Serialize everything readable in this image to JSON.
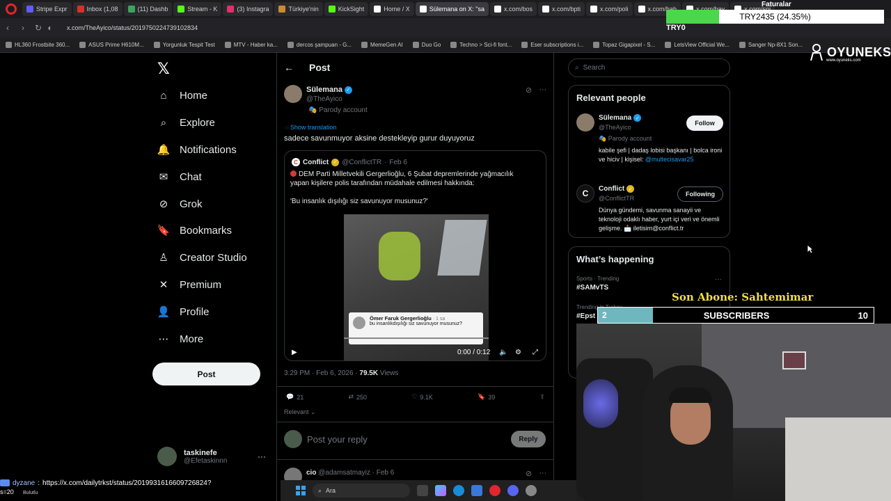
{
  "browser": {
    "tabs": [
      {
        "label": "Stripe Expr",
        "color": "#635bff",
        "active": false
      },
      {
        "label": "Inbox (1,08",
        "color": "#d93025",
        "active": false
      },
      {
        "label": "(11) Dashb",
        "color": "#3aa55d",
        "active": false
      },
      {
        "label": "Stream - K",
        "color": "#53fc18",
        "active": false
      },
      {
        "label": "(3) Instagra",
        "color": "#e1306c",
        "active": false
      },
      {
        "label": "Türkiye'nin",
        "color": "#c98c2d",
        "active": false
      },
      {
        "label": "KickSight",
        "color": "#53fc18",
        "active": false
      },
      {
        "label": "Home / X",
        "color": "#ffffff",
        "active": false
      },
      {
        "label": "Sülemana on X: \"sa",
        "color": "#ffffff",
        "active": true
      },
      {
        "label": "x.com/bos",
        "color": "#ffffff",
        "active": false
      },
      {
        "label": "x.com/bpti",
        "color": "#ffffff",
        "active": false
      },
      {
        "label": "x.com/poli",
        "color": "#ffffff",
        "active": false
      },
      {
        "label": "x.com/hab",
        "color": "#ffffff",
        "active": false
      },
      {
        "label": "x.com/bay",
        "color": "#ffffff",
        "active": false
      },
      {
        "label": "x.com/spi",
        "color": "#ffffff",
        "active": false
      }
    ],
    "url": "x.com/TheAyico/status/2019750224739102834",
    "bookmarks": [
      "HL360 Frostbite 360...",
      "ASUS Prime H610M...",
      "Yorgunluk Tespit Test",
      "MTV - Haber ka...",
      "dercos şampuan - G...",
      "MemeGen AI",
      "Duo Go",
      "Techno > Sci-fi font...",
      "Eser subscriptions i...",
      "Topaz Gigapixel - S...",
      "LetsView Official We...",
      "Sanger Np-8X1 Son..."
    ]
  },
  "nav": {
    "items": [
      {
        "label": "Home",
        "icon": "home-icon"
      },
      {
        "label": "Explore",
        "icon": "search-icon"
      },
      {
        "label": "Notifications",
        "icon": "bell-icon"
      },
      {
        "label": "Chat",
        "icon": "mail-icon"
      },
      {
        "label": "Grok",
        "icon": "grok-icon"
      },
      {
        "label": "Bookmarks",
        "icon": "bookmark-icon"
      },
      {
        "label": "Creator Studio",
        "icon": "creator-icon"
      },
      {
        "label": "Premium",
        "icon": "x-icon"
      },
      {
        "label": "Profile",
        "icon": "person-icon"
      },
      {
        "label": "More",
        "icon": "more-icon"
      }
    ],
    "post_label": "Post",
    "user_name": "taskinefe",
    "user_handle": "@Efetaskinnn"
  },
  "post": {
    "header": "Post",
    "author_name": "Sülemana",
    "author_handle": "@TheAyico",
    "parody_label": "Parody account",
    "translate_label": "Show translation",
    "text": "sadece savunmuyor aksine destekleyip gurur duyuyoruz",
    "quote": {
      "avatar_letter": "C",
      "name": "Conflict",
      "handle": "@ConflictTR",
      "date": "Feb 6",
      "text": "DEM Parti Milletvekili Gergerlioğlu, 6 Şubat depremlerinde yağmacılık yapan kişilere polis tarafından müdahale edilmesi hakkında:\n\n'Bu insanlık dışılığı siz savunuyor musunuz?'",
      "card_name": "Ömer Faruk Gergerlioğlu",
      "card_time": "1 sa",
      "card_text": "bu insanlıkdışılığı siz savunuyor musunuz?",
      "video_time": "0:00 / 0:12"
    },
    "time": "3:29 PM",
    "date": "Feb 6, 2026",
    "views": "79.5K",
    "views_label": "Views",
    "replies": "21",
    "reposts": "250",
    "likes": "9.1K",
    "bookmarks": "39",
    "sort_label": "Relevant",
    "reply_placeholder": "Post your reply",
    "reply_button": "Reply",
    "next_reply_name": "cio",
    "next_reply_handle": "@adamsatmayiz",
    "next_reply_date": "Feb 6"
  },
  "sidebar": {
    "search_placeholder": "Search",
    "relevant_title": "Relevant people",
    "people": [
      {
        "name": "Sülemana",
        "handle": "@TheAyico",
        "parody": "Parody account",
        "bio": "kabile şefi | dadaş lobisi başkanı | bolca ironi ve hiciv | kişisel:",
        "bio_link": "@multecisavar25",
        "button": "Follow"
      },
      {
        "name": "Conflict",
        "handle": "@ConflictTR",
        "bio": "Dünya gündemi, savunma sanayii ve teknoloji odaklı haber, yurt içi veri ve önemli gelişme. 📩 iletisim@conflict.tr",
        "button": "Following"
      }
    ],
    "happening_title": "What’s happening",
    "trends": [
      {
        "category": "Sports · Trending",
        "name": "#SAMvTS"
      },
      {
        "category": "Trending in Turkey",
        "name": "#Epst"
      }
    ]
  },
  "overlay": {
    "faturalar": "Faturalar",
    "try_label": "TRY2435 (24.35%)",
    "try_progress": 24.35,
    "try_zero": "TRY0",
    "brand": "OYUNEKS",
    "brand_sub": "www.oyuneks.com",
    "son_abone": "Son Abone: Sahtemimar",
    "subs_current": "2",
    "subs_label": "SUBSCRIBERS",
    "subs_goal": "10",
    "chat_user": "dyzane",
    "chat_message": "https://x.com/dailytrkst/status/2019931616609726824?",
    "chat_prefix": "s=20",
    "weather": "Bulutlu",
    "taskbar_search": "Ara"
  }
}
